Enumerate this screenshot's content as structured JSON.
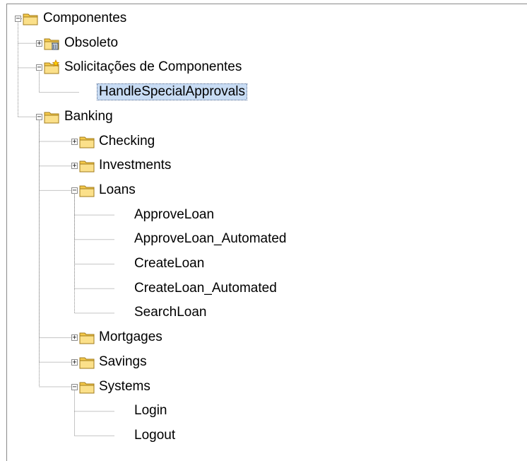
{
  "tree": {
    "root": {
      "label": "Componentes",
      "expanded": true,
      "icon": "folder-icon"
    },
    "items": [
      {
        "label": "Obsoleto",
        "icon": "folder-trash-icon",
        "expanded": false
      },
      {
        "label": "Solicitações de Componentes",
        "icon": "folder-new-icon",
        "expanded": true
      },
      {
        "label": "HandleSpecialApprovals",
        "icon": "component-request-icon",
        "selected": true
      },
      {
        "label": "Banking",
        "icon": "folder-icon",
        "expanded": true
      },
      {
        "label": "Checking",
        "icon": "folder-icon",
        "expanded": false
      },
      {
        "label": "Investments",
        "icon": "folder-icon",
        "expanded": false
      },
      {
        "label": "Loans",
        "icon": "folder-icon",
        "expanded": true
      },
      {
        "label": "ApproveLoan",
        "icon": "manual-component-icon"
      },
      {
        "label": "ApproveLoan_Automated",
        "icon": "automated-component-icon"
      },
      {
        "label": "CreateLoan",
        "icon": "manual-component-icon"
      },
      {
        "label": "CreateLoan_Automated",
        "icon": "automated-component-icon"
      },
      {
        "label": "SearchLoan",
        "icon": "manual-component-icon"
      },
      {
        "label": "Mortgages",
        "icon": "folder-icon",
        "expanded": false
      },
      {
        "label": "Savings",
        "icon": "folder-icon",
        "expanded": false
      },
      {
        "label": "Systems",
        "icon": "folder-icon",
        "expanded": true
      },
      {
        "label": "Login",
        "icon": "manual-component-icon"
      },
      {
        "label": "Logout",
        "icon": "manual-component-icon"
      }
    ]
  },
  "colors": {
    "selection": "#c8dcf4",
    "folder": "#f5c94a",
    "component": "#2f6fb5",
    "warning": "#f0b400"
  }
}
